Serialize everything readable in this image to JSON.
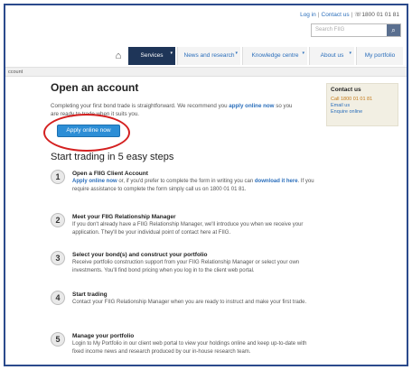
{
  "topbar": {
    "login": "Log in",
    "separator": "|",
    "contact": "Contact us",
    "phone": "1800 01 01 81"
  },
  "search": {
    "placeholder": "Search FIIG",
    "icon": "search-icon"
  },
  "nav": {
    "home_icon": "home-icon",
    "items": [
      {
        "label": "Services"
      },
      {
        "label": "News and research"
      },
      {
        "label": "Knowledge centre"
      },
      {
        "label": "About us"
      },
      {
        "label": "My portfolio"
      }
    ]
  },
  "breadcrumb": {
    "text": "ccount"
  },
  "main": {
    "title": "Open an account",
    "intro_a": "Completing your first bond trade is straightforward. We recommend you ",
    "intro_link": "apply online now",
    "intro_b": " so you",
    "intro_c": "are ready to trade when it suits you.",
    "apply_button": "Apply online now"
  },
  "contact_box": {
    "heading": "Contact us",
    "call": "Call 1800 01 01 81",
    "email": "Email us",
    "enquire": "Enquire online"
  },
  "steps": {
    "heading": "Start trading in 5 easy steps",
    "items": [
      {
        "num": "1",
        "title": "Open a FIIG Client Account",
        "link_a": "Apply online now",
        "text_a": " or, if you'd prefer to complete the form in writing you can ",
        "link_b": "download it here",
        "text_b": ". If you require assistance to complete the form simply call us on 1800 01 01 81."
      },
      {
        "num": "2",
        "title": "Meet your FIIG Relationship Manager",
        "text": "If you don't already have a FIIG Relationship Manager, we'll introduce you when we receive your application. They'll be your individual point of contact here at FIIG."
      },
      {
        "num": "3",
        "title": "Select your bond(s) and construct your portfolio",
        "text": "Receive portfolio construction support from your FIIG Relationship Manager or select your own investments. You'll find bond pricing when you log in to the client web portal."
      },
      {
        "num": "4",
        "title": "Start trading",
        "text": "Contact your FIIG Relationship Manager when you are ready to instruct and make your first trade."
      },
      {
        "num": "5",
        "title": "Manage your portfolio",
        "text": "Login to My Portfolio in our client web portal to view your holdings online and keep up-to-date with fixed income news and research produced by our in-house research team."
      }
    ]
  },
  "colors": {
    "nav_active": "#1e3558",
    "link": "#2a6ebb",
    "button": "#2d8ed6",
    "highlight_circle": "#d42020",
    "frame": "#2b4a8c"
  }
}
